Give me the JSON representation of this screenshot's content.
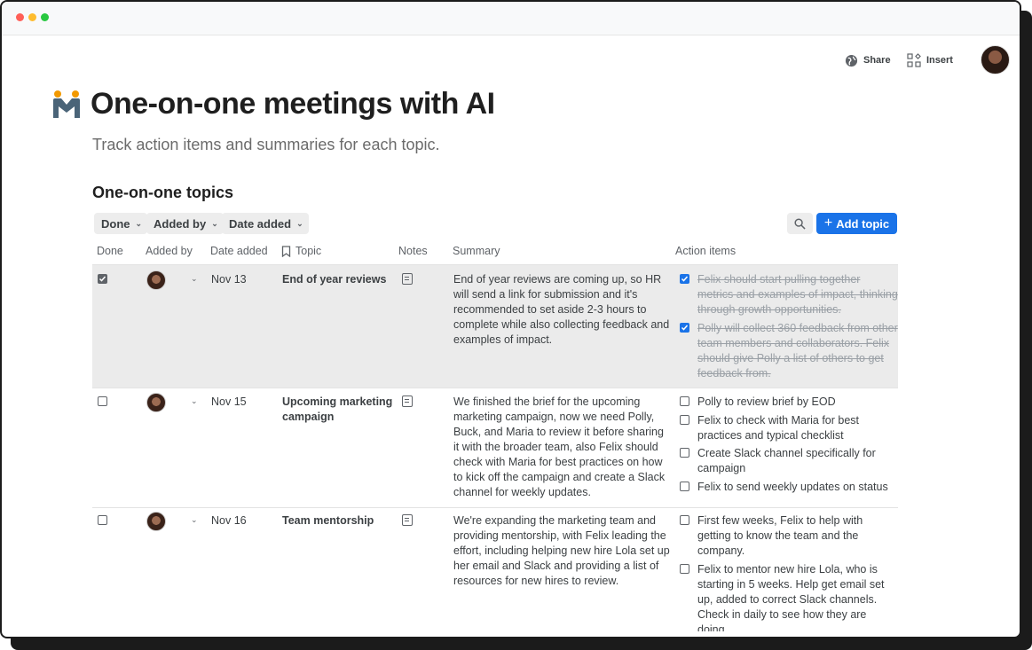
{
  "toolbar": {
    "share_label": "Share",
    "insert_label": "Insert"
  },
  "page": {
    "title": "One-on-one meetings with AI",
    "subtitle": "Track action items and summaries for each topic.",
    "section_title": "One-on-one topics"
  },
  "filters": [
    {
      "label": "Done"
    },
    {
      "label": "Added by"
    },
    {
      "label": "Date added"
    }
  ],
  "add_button": "Add topic",
  "columns": {
    "done": "Done",
    "added_by": "Added by",
    "date_added": "Date added",
    "topic": "Topic",
    "notes": "Notes",
    "summary": "Summary",
    "action_items": "Action items"
  },
  "rows": [
    {
      "done": true,
      "date": "Nov 13",
      "topic": "End of year reviews",
      "summary": "End of year reviews are coming up, so HR will send a link for submission and it's recommended to set aside 2-3 hours to complete while also collecting feedback and examples of impact.",
      "action_items": [
        {
          "text": "Felix should start pulling together metrics and examples of impact, thinking through growth opportunities.",
          "checked": true
        },
        {
          "text": "Polly will collect 360 feedback from other team members and collaborators. Felix should give Polly a list of others to get feedback from.",
          "checked": true
        }
      ]
    },
    {
      "done": false,
      "date": "Nov 15",
      "topic": "Upcoming marketing campaign",
      "summary": "We finished the brief for the upcoming marketing campaign, now we need Polly, Buck, and Maria to review it before sharing it with the broader team, also Felix should check with Maria for best practices on how to kick off the campaign and create a Slack channel for weekly updates.",
      "action_items": [
        {
          "text": "Polly to review brief by EOD",
          "checked": false
        },
        {
          "text": "Felix to check with Maria for best practices and typical checklist",
          "checked": false
        },
        {
          "text": "Create Slack channel specifically for campaign",
          "checked": false
        },
        {
          "text": "Felix to send weekly updates on status",
          "checked": false
        }
      ]
    },
    {
      "done": false,
      "date": "Nov 16",
      "topic": "Team mentorship",
      "summary": "We're expanding the marketing team and providing mentorship, with Felix leading the effort, including helping new hire Lola set up her email and Slack and providing a list of resources for new hires to review.",
      "action_items": [
        {
          "text": "First few weeks, Felix to help with getting to know the team and the company.",
          "checked": false
        },
        {
          "text": "Felix to mentor new hire Lola, who is starting in 5 weeks. Help get email set up, added to correct Slack channels. Check in daily to see how they are doing.",
          "checked": false
        }
      ]
    }
  ],
  "colors": {
    "accent": "#1a73e8",
    "row_highlight": "#ebebeb"
  }
}
